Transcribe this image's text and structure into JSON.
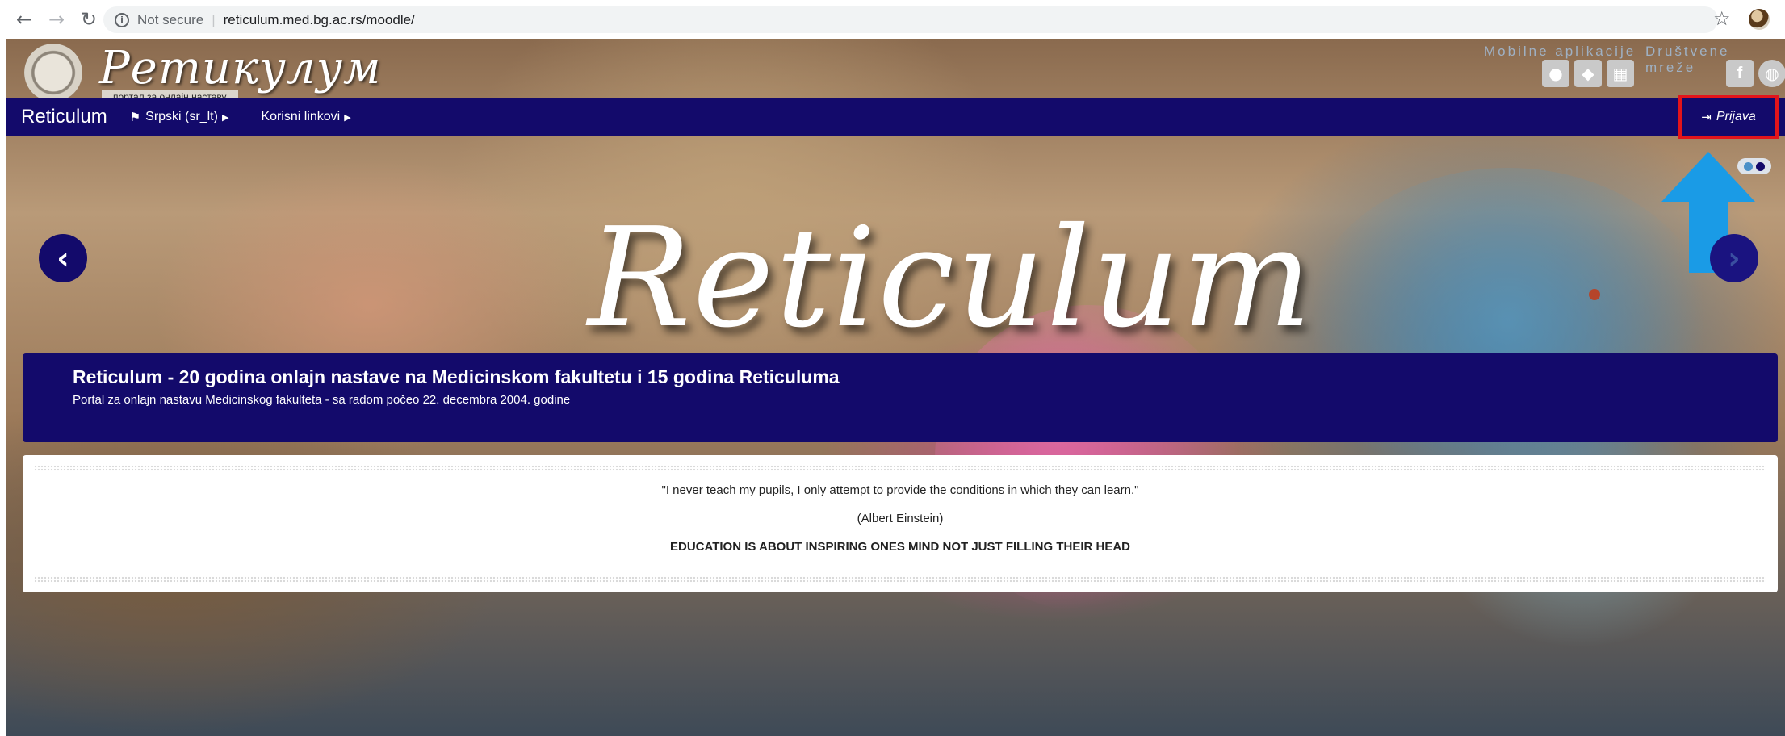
{
  "browser": {
    "back_icon": "arrow-left-icon",
    "forward_icon": "arrow-right-icon",
    "reload_icon": "reload-icon",
    "security_label": "Not secure",
    "separator": "|",
    "url": "reticulum.med.bg.ac.rs/moodle/"
  },
  "header": {
    "logo_wordmark": "Ретикулум",
    "logo_tagline": "портал за онлајн наставу",
    "mobile_apps_label": "Mobilne aplikacije",
    "social_label": "Društvene mreže",
    "app_icons": [
      "apple-icon",
      "android-icon",
      "windows-icon"
    ],
    "social_icons": [
      "facebook-icon",
      "globe-icon"
    ]
  },
  "navbar": {
    "brand": "Reticulum",
    "language": "Srpski (sr_lt)",
    "links": "Korisni linkovi",
    "login": "Prijava"
  },
  "carousel": {
    "hero_title": "Reticulum",
    "slide_count": 2,
    "active_slide": 1,
    "caption_title": "Reticulum - 20 godina onlajn nastave na Medicinskom fakultetu i 15 godina Reticuluma",
    "caption_subtitle": "Portal za onlajn nastavu Medicinskog fakulteta - sa radom počeo 22. decembra 2004. godine"
  },
  "quote": {
    "text": "\"I never teach my pupils, I only attempt to provide the conditions in which they can learn.\"",
    "author": "(Albert Einstein)",
    "motto": "EDUCATION IS ABOUT INSPIRING ONES MIND NOT JUST FILLING THEIR HEAD"
  },
  "colors": {
    "navbar": "#130a6b",
    "highlight": "#e3141b",
    "annotation_arrow": "#1a9be6"
  }
}
